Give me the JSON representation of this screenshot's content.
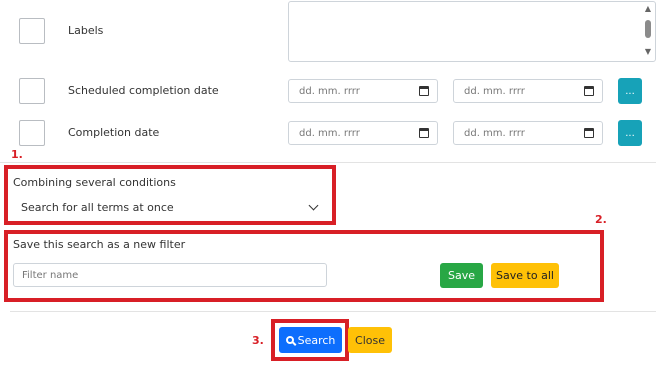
{
  "rows": [
    {
      "label": "Labels"
    },
    {
      "label": "Scheduled completion date",
      "date_from_placeholder": "dd. mm. rrrr",
      "date_to_placeholder": "dd. mm. rrrr",
      "button_label": "..."
    },
    {
      "label": "Completion date",
      "date_from_placeholder": "dd. mm. rrrr",
      "date_to_placeholder": "dd. mm. rrrr",
      "button_label": "..."
    }
  ],
  "annotations": {
    "one": "1.",
    "two": "2.",
    "three": "3."
  },
  "combining": {
    "label": "Combining several conditions",
    "selected": "Search for all terms at once"
  },
  "save_filter": {
    "label": "Save this search as a new filter",
    "placeholder": "Filter name",
    "save_label": "Save",
    "save_to_all_label": "Save to all"
  },
  "footer": {
    "search_label": "Search",
    "close_label": "Close"
  },
  "colors": {
    "annotation_red": "#d81f26",
    "info": "#17a2b8",
    "success": "#28a745",
    "warning": "#ffc107",
    "primary": "#0d6efd"
  }
}
